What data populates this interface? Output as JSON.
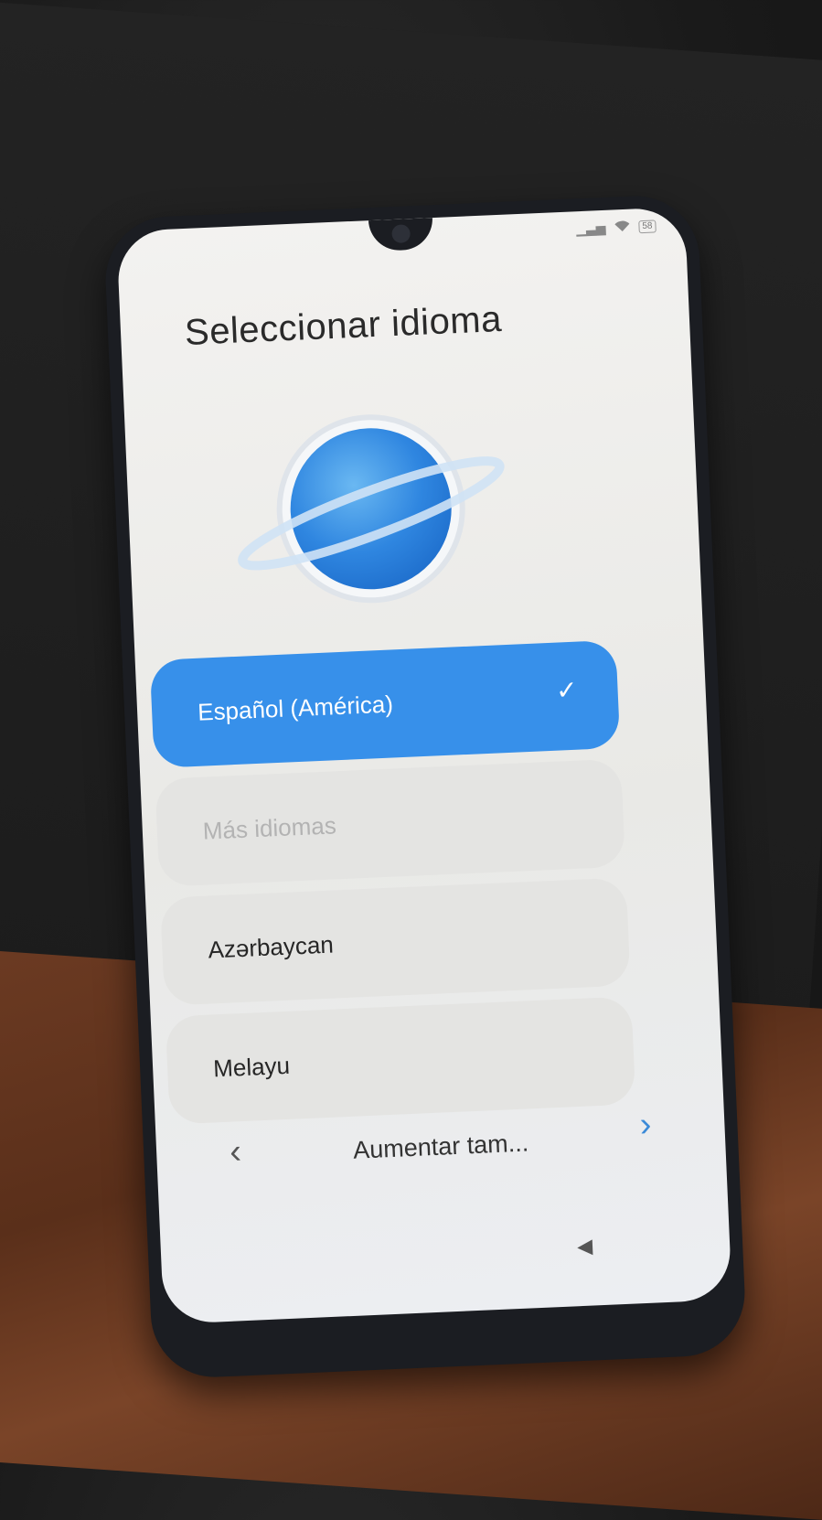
{
  "screen": {
    "title": "Seleccionar idioma",
    "status_battery": "58"
  },
  "languages": [
    {
      "label": "Español (América)",
      "selected": true
    },
    {
      "label": "Más idiomas",
      "selected": false
    },
    {
      "label": "Azərbaycan",
      "selected": false
    },
    {
      "label": "Melayu",
      "selected": false
    }
  ],
  "footer": {
    "label": "Aumentar tam...",
    "back_icon": "chevron-left-icon",
    "next_icon": "chevron-right-icon"
  },
  "colors": {
    "accent": "#3790ea",
    "item_bg": "#e4e4e2"
  }
}
